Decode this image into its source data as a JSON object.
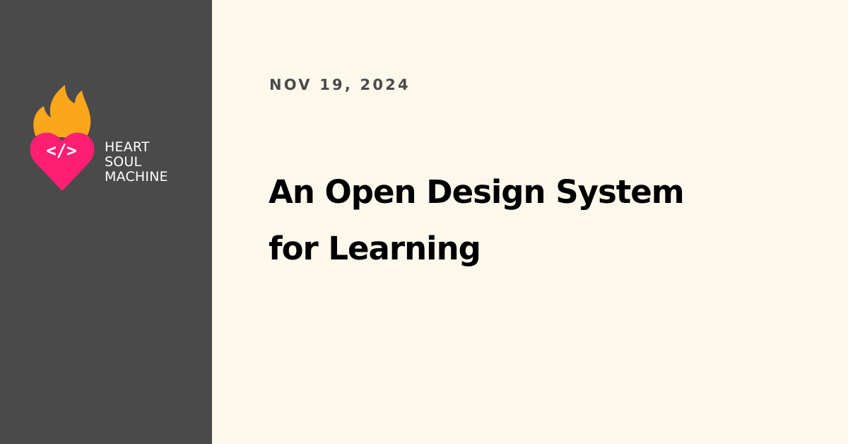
{
  "brand": {
    "wordmark_line1": "HEART",
    "wordmark_line2": "SOUL",
    "wordmark_line3": "MACHINE",
    "logo_symbol": "</>",
    "colors": {
      "sidebar": "#4a4a4a",
      "background": "#fdf8ec",
      "heart": "#ff1f72",
      "flame": "#fba61b",
      "wordmark": "#ffffff"
    },
    "icons": [
      "flame-icon",
      "heart-icon",
      "code-brackets-icon"
    ]
  },
  "post": {
    "date": "NOV 19, 2024",
    "title_line1": "An Open Design System",
    "title_line2": "for Learning"
  }
}
